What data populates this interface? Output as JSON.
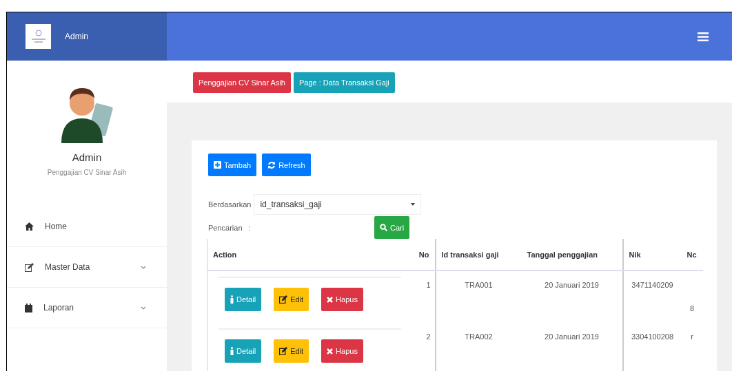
{
  "header": {
    "brand": "Admin"
  },
  "profile": {
    "name": "Admin",
    "subtitle": "Penggajian CV Sinar Asih"
  },
  "sidebar": {
    "items": [
      {
        "label": "Home",
        "expandable": false
      },
      {
        "label": "Master Data",
        "expandable": true
      },
      {
        "label": "Laporan",
        "expandable": true
      }
    ]
  },
  "breadcrumb": [
    {
      "label": "Penggajian CV Sinar Asih",
      "kind": "danger"
    },
    {
      "label": "Page : Data Transaksi Gaji",
      "kind": "info"
    }
  ],
  "toolbar": [
    {
      "label": "Tambah"
    },
    {
      "label": "Refresh"
    }
  ],
  "filter": {
    "label": "Berdasarkan",
    "value": "id_transaksi_gaji"
  },
  "search": {
    "label": "Pencarian   :",
    "button": "Cari"
  },
  "table": {
    "columns": [
      "Action",
      "No",
      "Id transaksi gaji",
      "Tanggal penggajian",
      "Nik",
      "Nc"
    ],
    "rows": [
      {
        "actions": [
          {
            "label": "Detail",
            "kind": "info"
          },
          {
            "label": "Edit",
            "kind": "warning"
          },
          {
            "label": "Hapus",
            "kind": "danger"
          }
        ],
        "no": "1",
        "id": "TRA001",
        "date": "20 Januari 2019",
        "nik": "3471140209",
        "column_6": "8"
      },
      {
        "actions": [
          {
            "label": "Detail",
            "kind": "info"
          },
          {
            "label": "Edit",
            "kind": "warning"
          },
          {
            "label": "Hapus",
            "kind": "danger"
          }
        ],
        "no": "2",
        "id": "TRA002",
        "date": "20 Januari 2019",
        "nik": "3304100208",
        "column_6": "r"
      }
    ]
  }
}
